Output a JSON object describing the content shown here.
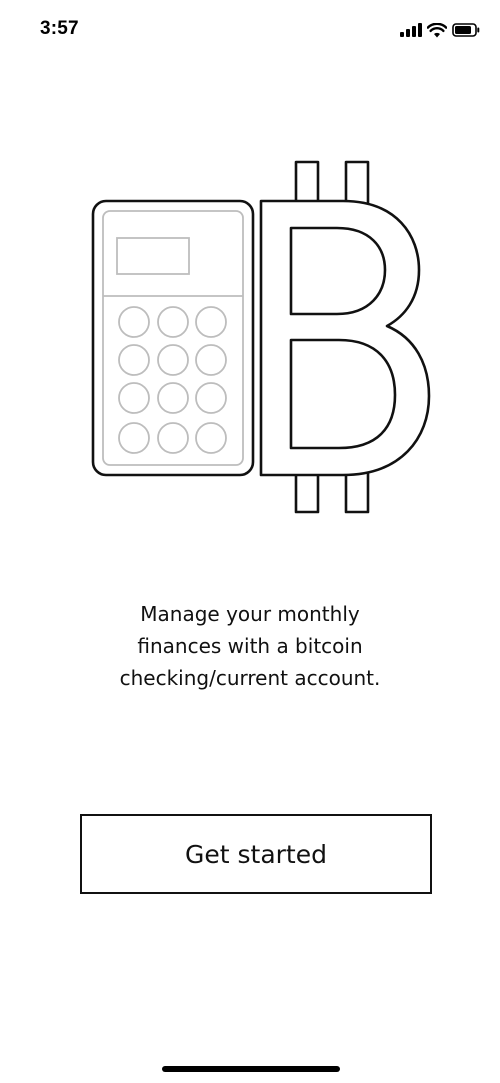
{
  "status_bar": {
    "time": "3:57",
    "icons": [
      "cellular-signal-icon",
      "wifi-icon",
      "battery-icon"
    ]
  },
  "illustration": {
    "icons": [
      "calculator-icon",
      "bitcoin-icon"
    ]
  },
  "onboarding": {
    "message": "Manage your monthly\nfinances with a bitcoin\nchecking/current account.",
    "button_label": "Get started"
  },
  "colors": {
    "ink": "#111111",
    "keypad_gray": "#bdbdbd",
    "background": "#ffffff"
  }
}
